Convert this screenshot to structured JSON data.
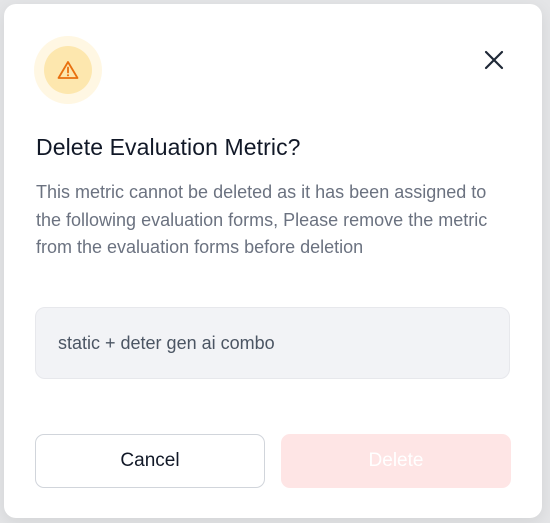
{
  "dialog": {
    "title": "Delete Evaluation Metric?",
    "description": "This metric cannot be deleted as it has been assigned to the following evaluation forms, Please remove the metric from the evaluation forms before deletion",
    "warning_icon": "warning-triangle-icon",
    "close_icon": "close-icon",
    "assigned_forms": [
      "static + deter gen ai combo"
    ],
    "cancel_label": "Cancel",
    "delete_label": "Delete",
    "delete_disabled": true,
    "colors": {
      "warning_accent": "#e8700e",
      "warning_bg": "#fde7ae",
      "delete_disabled_bg": "#fee5e5"
    }
  }
}
